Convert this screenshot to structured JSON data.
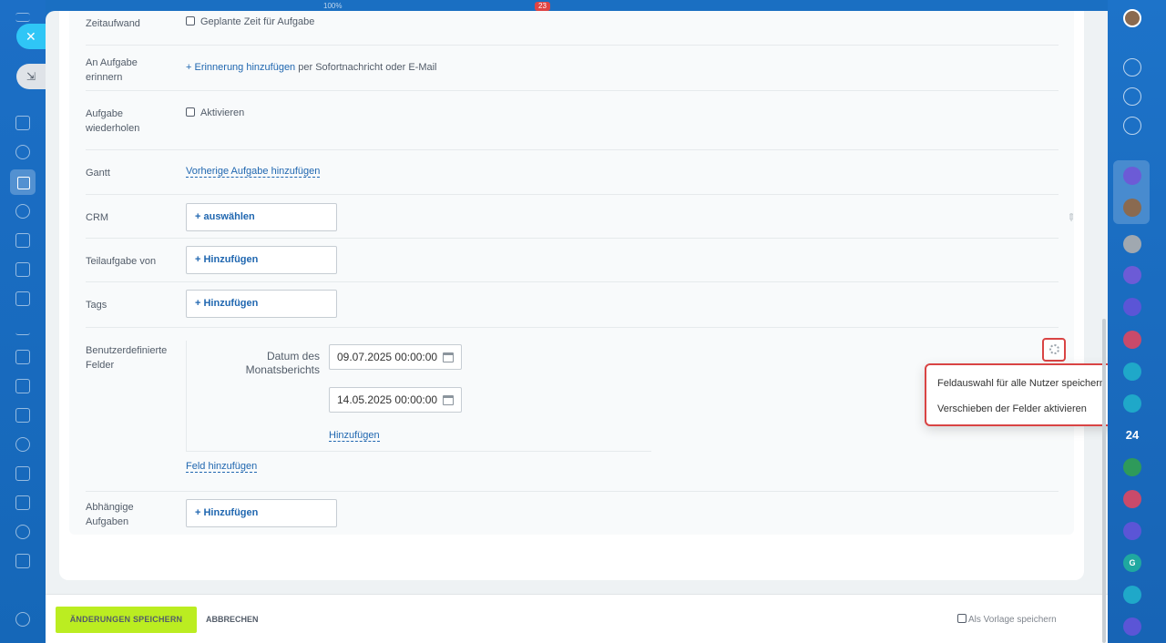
{
  "top_bar": {
    "zoom": "100%",
    "badge": "23"
  },
  "form": {
    "zeitaufwand": {
      "label": "Zeitaufwand",
      "checkbox_label": "Geplante Zeit für Aufgabe"
    },
    "erinnern": {
      "label_line1": "An Aufgabe",
      "label_line2": "erinnern",
      "link": "+ Erinnerung hinzufügen",
      "suffix": "per Sofortnachricht oder E-Mail"
    },
    "wiederholen": {
      "label_line1": "Aufgabe",
      "label_line2": "wiederholen",
      "checkbox_label": "Aktivieren"
    },
    "gantt": {
      "label": "Gantt",
      "link": "Vorherige Aufgabe hinzufügen"
    },
    "crm": {
      "label": "CRM",
      "button": "+  auswählen"
    },
    "teilaufgabe": {
      "label": "Teilaufgabe von",
      "button": "+  Hinzufügen"
    },
    "tags": {
      "label": "Tags",
      "button": "+  Hinzufügen"
    },
    "custom_fields": {
      "label_line1": "Benutzerdefinierte",
      "label_line2": "Felder",
      "field_label_line1": "Datum des",
      "field_label_line2": "Monatsberichts",
      "date1": "09.07.2025 00:00:00",
      "date2": "14.05.2025 00:00:00",
      "add_value_link": "Hinzufügen",
      "add_field_link": "Feld hinzufügen"
    },
    "abhaengige": {
      "label_line1": "Abhängige",
      "label_line2": "Aufgaben",
      "button": "+  Hinzufügen"
    }
  },
  "popup_menu": {
    "items": [
      "Feldauswahl für alle Nutzer speichern",
      "Verschieben der Felder aktivieren"
    ]
  },
  "footer": {
    "save": "ÄNDERUNGEN SPEICHERN",
    "cancel": "ABBRECHEN",
    "template": "Als Vorlage speichern"
  },
  "right_bar": {
    "counter": "24",
    "letter_g": "G"
  },
  "colors": {
    "accent_green": "#bbed21",
    "link_blue": "#2067b0",
    "highlight_red": "#d94444",
    "sidebar_blue": "#1a6fc2"
  }
}
